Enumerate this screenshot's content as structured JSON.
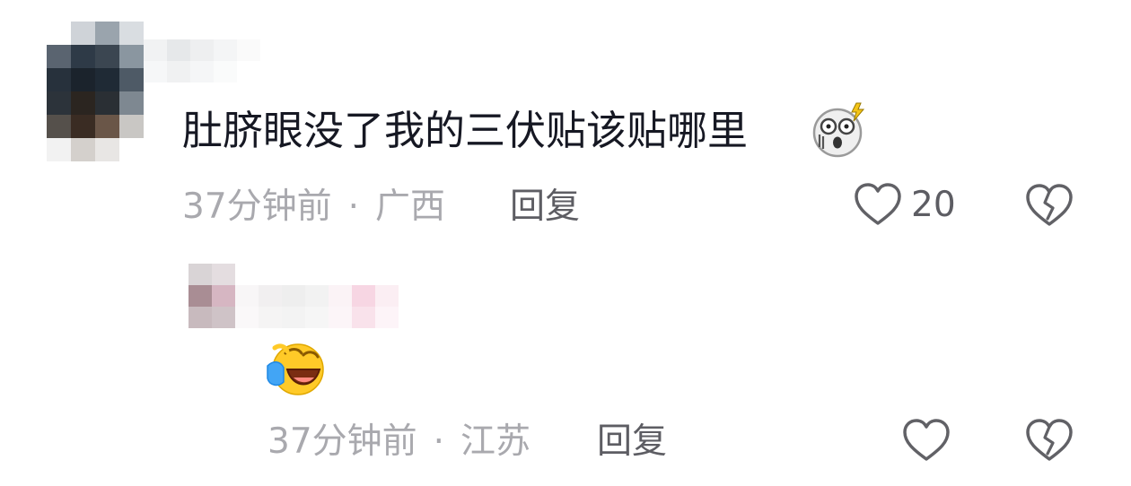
{
  "comments": [
    {
      "text": "肚脐眼没了我的三伏贴该贴哪里",
      "emoji_icon": "shocked-face-icon",
      "time": "37分钟前",
      "separator": "·",
      "location": "广西",
      "reply_label": "回复",
      "like_icon": "heart-outline-icon",
      "like_count": "20",
      "dislike_icon": "broken-heart-icon"
    },
    {
      "emoji_icon": "laughing-crying-face-icon",
      "time": "37分钟前",
      "separator": "·",
      "location": "江苏",
      "reply_label": "回复",
      "like_icon": "heart-outline-icon",
      "dislike_icon": "broken-heart-icon"
    }
  ],
  "colors": {
    "text_primary": "#161823",
    "text_meta": "#a9a9ae",
    "text_action": "#5d5d63",
    "icon_stroke": "#616166"
  }
}
